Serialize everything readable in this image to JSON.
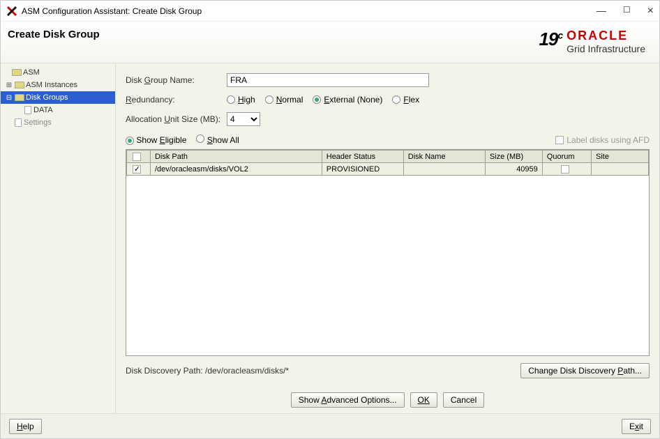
{
  "window": {
    "title": "ASM Configuration Assistant: Create Disk Group"
  },
  "header": {
    "title": "Create Disk Group",
    "version": "19",
    "version_sup": "c",
    "brand": "ORACLE",
    "brand_sub": "Grid Infrastructure"
  },
  "sidebar": {
    "root": "ASM",
    "items": [
      {
        "label": "ASM Instances"
      },
      {
        "label": "Disk Groups",
        "selected": true,
        "children": [
          {
            "label": "DATA"
          }
        ]
      },
      {
        "label": "Settings"
      }
    ]
  },
  "form": {
    "disk_group_name_label": "Disk Group Name:",
    "disk_group_name_value": "FRA",
    "redundancy_label": "Redundancy:",
    "redundancy": {
      "options": [
        {
          "label": "High",
          "mn": "H",
          "rest": "igh",
          "selected": false
        },
        {
          "label": "Normal",
          "mn": "N",
          "rest": "ormal",
          "selected": false
        },
        {
          "label": "External (None)",
          "mn": "E",
          "rest": "xternal (None)",
          "selected": true
        },
        {
          "label": "Flex",
          "mn": "F",
          "rest": "lex",
          "selected": false
        }
      ]
    },
    "aus_label": "Allocation Unit Size (MB):",
    "aus_value": "4",
    "filter_eligible": "Show Eligible",
    "filter_all": "Show All",
    "filter_selected": "eligible",
    "label_afd": "Label disks using AFD"
  },
  "table": {
    "columns": [
      "",
      "Disk Path",
      "Header Status",
      "Disk Name",
      "Size (MB)",
      "Quorum",
      "Site"
    ],
    "rows": [
      {
        "checked": true,
        "disk_path": "/dev/oracleasm/disks/VOL2",
        "header_status": "PROVISIONED",
        "disk_name": "",
        "size_mb": "40959",
        "quorum": false,
        "site": ""
      }
    ]
  },
  "discovery": {
    "label": "Disk Discovery Path:",
    "path": "/dev/oracleasm/disks/*",
    "button": "Change Disk Discovery Path..."
  },
  "buttons": {
    "advanced": "Show Advanced Options...",
    "ok": "OK",
    "cancel": "Cancel",
    "help": "Help",
    "exit": "Exit"
  }
}
